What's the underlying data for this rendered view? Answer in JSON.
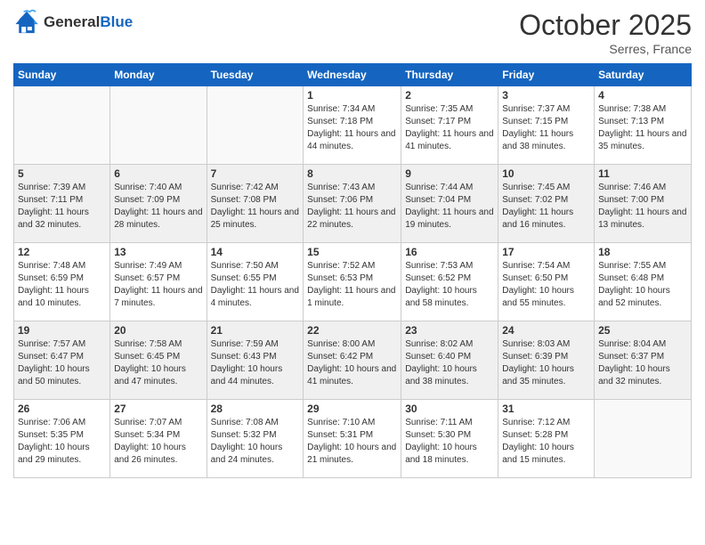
{
  "header": {
    "logo_general": "General",
    "logo_blue": "Blue",
    "month_title": "October 2025",
    "location": "Serres, France"
  },
  "days_of_week": [
    "Sunday",
    "Monday",
    "Tuesday",
    "Wednesday",
    "Thursday",
    "Friday",
    "Saturday"
  ],
  "weeks": [
    [
      {
        "day": "",
        "info": ""
      },
      {
        "day": "",
        "info": ""
      },
      {
        "day": "",
        "info": ""
      },
      {
        "day": "1",
        "info": "Sunrise: 7:34 AM\nSunset: 7:18 PM\nDaylight: 11 hours and 44 minutes."
      },
      {
        "day": "2",
        "info": "Sunrise: 7:35 AM\nSunset: 7:17 PM\nDaylight: 11 hours and 41 minutes."
      },
      {
        "day": "3",
        "info": "Sunrise: 7:37 AM\nSunset: 7:15 PM\nDaylight: 11 hours and 38 minutes."
      },
      {
        "day": "4",
        "info": "Sunrise: 7:38 AM\nSunset: 7:13 PM\nDaylight: 11 hours and 35 minutes."
      }
    ],
    [
      {
        "day": "5",
        "info": "Sunrise: 7:39 AM\nSunset: 7:11 PM\nDaylight: 11 hours and 32 minutes."
      },
      {
        "day": "6",
        "info": "Sunrise: 7:40 AM\nSunset: 7:09 PM\nDaylight: 11 hours and 28 minutes."
      },
      {
        "day": "7",
        "info": "Sunrise: 7:42 AM\nSunset: 7:08 PM\nDaylight: 11 hours and 25 minutes."
      },
      {
        "day": "8",
        "info": "Sunrise: 7:43 AM\nSunset: 7:06 PM\nDaylight: 11 hours and 22 minutes."
      },
      {
        "day": "9",
        "info": "Sunrise: 7:44 AM\nSunset: 7:04 PM\nDaylight: 11 hours and 19 minutes."
      },
      {
        "day": "10",
        "info": "Sunrise: 7:45 AM\nSunset: 7:02 PM\nDaylight: 11 hours and 16 minutes."
      },
      {
        "day": "11",
        "info": "Sunrise: 7:46 AM\nSunset: 7:00 PM\nDaylight: 11 hours and 13 minutes."
      }
    ],
    [
      {
        "day": "12",
        "info": "Sunrise: 7:48 AM\nSunset: 6:59 PM\nDaylight: 11 hours and 10 minutes."
      },
      {
        "day": "13",
        "info": "Sunrise: 7:49 AM\nSunset: 6:57 PM\nDaylight: 11 hours and 7 minutes."
      },
      {
        "day": "14",
        "info": "Sunrise: 7:50 AM\nSunset: 6:55 PM\nDaylight: 11 hours and 4 minutes."
      },
      {
        "day": "15",
        "info": "Sunrise: 7:52 AM\nSunset: 6:53 PM\nDaylight: 11 hours and 1 minute."
      },
      {
        "day": "16",
        "info": "Sunrise: 7:53 AM\nSunset: 6:52 PM\nDaylight: 10 hours and 58 minutes."
      },
      {
        "day": "17",
        "info": "Sunrise: 7:54 AM\nSunset: 6:50 PM\nDaylight: 10 hours and 55 minutes."
      },
      {
        "day": "18",
        "info": "Sunrise: 7:55 AM\nSunset: 6:48 PM\nDaylight: 10 hours and 52 minutes."
      }
    ],
    [
      {
        "day": "19",
        "info": "Sunrise: 7:57 AM\nSunset: 6:47 PM\nDaylight: 10 hours and 50 minutes."
      },
      {
        "day": "20",
        "info": "Sunrise: 7:58 AM\nSunset: 6:45 PM\nDaylight: 10 hours and 47 minutes."
      },
      {
        "day": "21",
        "info": "Sunrise: 7:59 AM\nSunset: 6:43 PM\nDaylight: 10 hours and 44 minutes."
      },
      {
        "day": "22",
        "info": "Sunrise: 8:00 AM\nSunset: 6:42 PM\nDaylight: 10 hours and 41 minutes."
      },
      {
        "day": "23",
        "info": "Sunrise: 8:02 AM\nSunset: 6:40 PM\nDaylight: 10 hours and 38 minutes."
      },
      {
        "day": "24",
        "info": "Sunrise: 8:03 AM\nSunset: 6:39 PM\nDaylight: 10 hours and 35 minutes."
      },
      {
        "day": "25",
        "info": "Sunrise: 8:04 AM\nSunset: 6:37 PM\nDaylight: 10 hours and 32 minutes."
      }
    ],
    [
      {
        "day": "26",
        "info": "Sunrise: 7:06 AM\nSunset: 5:35 PM\nDaylight: 10 hours and 29 minutes."
      },
      {
        "day": "27",
        "info": "Sunrise: 7:07 AM\nSunset: 5:34 PM\nDaylight: 10 hours and 26 minutes."
      },
      {
        "day": "28",
        "info": "Sunrise: 7:08 AM\nSunset: 5:32 PM\nDaylight: 10 hours and 24 minutes."
      },
      {
        "day": "29",
        "info": "Sunrise: 7:10 AM\nSunset: 5:31 PM\nDaylight: 10 hours and 21 minutes."
      },
      {
        "day": "30",
        "info": "Sunrise: 7:11 AM\nSunset: 5:30 PM\nDaylight: 10 hours and 18 minutes."
      },
      {
        "day": "31",
        "info": "Sunrise: 7:12 AM\nSunset: 5:28 PM\nDaylight: 10 hours and 15 minutes."
      },
      {
        "day": "",
        "info": ""
      }
    ]
  ],
  "row_colors": [
    "#ffffff",
    "#f0f0f0",
    "#ffffff",
    "#f0f0f0",
    "#f0f0f0"
  ]
}
